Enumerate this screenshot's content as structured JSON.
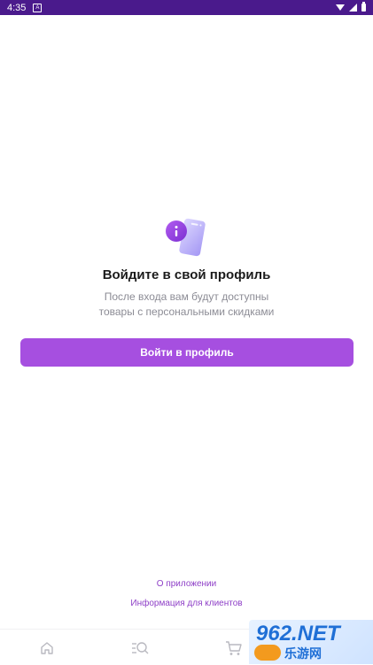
{
  "status_bar": {
    "time": "4:35",
    "badge": "A"
  },
  "login_prompt": {
    "title": "Войдите в свой профиль",
    "subtitle_line1": "После входа вам будут доступны",
    "subtitle_line2": "товары с персональными скидками",
    "button_label": "Войти в профиль"
  },
  "links": {
    "about": "О приложении",
    "customer_info": "Информация для клиентов"
  },
  "bottom_nav": {
    "items": [
      {
        "icon": "home-icon"
      },
      {
        "icon": "catalog-search-icon"
      },
      {
        "icon": "cart-icon"
      }
    ]
  },
  "watermark": {
    "line1": "962.NET",
    "line2": "乐游网"
  },
  "colors": {
    "status_bar": "#4a1a8c",
    "accent": "#a64fe0",
    "link": "#8e3fc7",
    "title": "#1b1b1b",
    "subtitle": "#8c8c95"
  }
}
